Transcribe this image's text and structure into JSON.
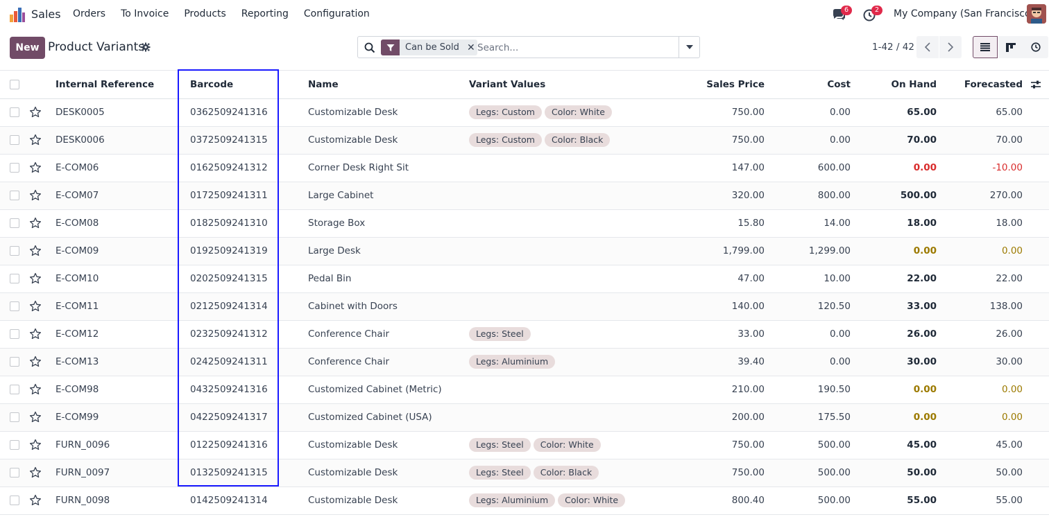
{
  "nav": {
    "app_name": "Sales",
    "menu": [
      "Orders",
      "To Invoice",
      "Products",
      "Reporting",
      "Configuration"
    ],
    "chat_badge": "6",
    "activity_badge": "2",
    "company": "My Company (San Francisco)"
  },
  "control": {
    "new_label": "New",
    "title": "Product Variants",
    "facet_label": "Can be Sold",
    "search_placeholder": "Search...",
    "pager": "1-42 / 42"
  },
  "table": {
    "headers": {
      "ref": "Internal Reference",
      "barcode": "Barcode",
      "name": "Name",
      "variants": "Variant Values",
      "price": "Sales Price",
      "cost": "Cost",
      "on_hand": "On Hand",
      "forecasted": "Forecasted"
    },
    "rows": [
      {
        "ref": "DESK0005",
        "barcode": "0362509241316",
        "name": "Customizable Desk",
        "tags": [
          "Legs: Custom",
          "Color: White"
        ],
        "price": "750.00",
        "cost": "0.00",
        "on_hand": "65.00",
        "forecasted": "65.00",
        "state": "normal"
      },
      {
        "ref": "DESK0006",
        "barcode": "0372509241315",
        "name": "Customizable Desk",
        "tags": [
          "Legs: Custom",
          "Color: Black"
        ],
        "price": "750.00",
        "cost": "0.00",
        "on_hand": "70.00",
        "forecasted": "70.00",
        "state": "normal"
      },
      {
        "ref": "E-COM06",
        "barcode": "0162509241312",
        "name": "Corner Desk Right Sit",
        "tags": [],
        "price": "147.00",
        "cost": "600.00",
        "on_hand": "0.00",
        "forecasted": "-10.00",
        "state": "negative"
      },
      {
        "ref": "E-COM07",
        "barcode": "0172509241311",
        "name": "Large Cabinet",
        "tags": [],
        "price": "320.00",
        "cost": "800.00",
        "on_hand": "500.00",
        "forecasted": "270.00",
        "state": "normal"
      },
      {
        "ref": "E-COM08",
        "barcode": "0182509241310",
        "name": "Storage Box",
        "tags": [],
        "price": "15.80",
        "cost": "14.00",
        "on_hand": "18.00",
        "forecasted": "18.00",
        "state": "normal"
      },
      {
        "ref": "E-COM09",
        "barcode": "0192509241319",
        "name": "Large Desk",
        "tags": [],
        "price": "1,799.00",
        "cost": "1,299.00",
        "on_hand": "0.00",
        "forecasted": "0.00",
        "state": "zero"
      },
      {
        "ref": "E-COM10",
        "barcode": "0202509241315",
        "name": "Pedal Bin",
        "tags": [],
        "price": "47.00",
        "cost": "10.00",
        "on_hand": "22.00",
        "forecasted": "22.00",
        "state": "normal"
      },
      {
        "ref": "E-COM11",
        "barcode": "0212509241314",
        "name": "Cabinet with Doors",
        "tags": [],
        "price": "140.00",
        "cost": "120.50",
        "on_hand": "33.00",
        "forecasted": "138.00",
        "state": "normal"
      },
      {
        "ref": "E-COM12",
        "barcode": "0232509241312",
        "name": "Conference Chair",
        "tags": [
          "Legs: Steel"
        ],
        "price": "33.00",
        "cost": "0.00",
        "on_hand": "26.00",
        "forecasted": "26.00",
        "state": "normal"
      },
      {
        "ref": "E-COM13",
        "barcode": "0242509241311",
        "name": "Conference Chair",
        "tags": [
          "Legs: Aluminium"
        ],
        "price": "39.40",
        "cost": "0.00",
        "on_hand": "30.00",
        "forecasted": "30.00",
        "state": "normal"
      },
      {
        "ref": "E-COM98",
        "barcode": "0432509241316",
        "name": "Customized Cabinet (Metric)",
        "tags": [],
        "price": "210.00",
        "cost": "190.50",
        "on_hand": "0.00",
        "forecasted": "0.00",
        "state": "zero"
      },
      {
        "ref": "E-COM99",
        "barcode": "0422509241317",
        "name": "Customized Cabinet (USA)",
        "tags": [],
        "price": "200.00",
        "cost": "175.50",
        "on_hand": "0.00",
        "forecasted": "0.00",
        "state": "zero"
      },
      {
        "ref": "FURN_0096",
        "barcode": "0122509241316",
        "name": "Customizable Desk",
        "tags": [
          "Legs: Steel",
          "Color: White"
        ],
        "price": "750.00",
        "cost": "500.00",
        "on_hand": "45.00",
        "forecasted": "45.00",
        "state": "normal"
      },
      {
        "ref": "FURN_0097",
        "barcode": "0132509241315",
        "name": "Customizable Desk",
        "tags": [
          "Legs: Steel",
          "Color: Black"
        ],
        "price": "750.00",
        "cost": "500.00",
        "on_hand": "50.00",
        "forecasted": "50.00",
        "state": "normal"
      },
      {
        "ref": "FURN_0098",
        "barcode": "0142509241314",
        "name": "Customizable Desk",
        "tags": [
          "Legs: Aluminium",
          "Color: White"
        ],
        "price": "800.40",
        "cost": "500.00",
        "on_hand": "55.00",
        "forecasted": "55.00",
        "state": "normal"
      }
    ]
  },
  "colors": {
    "brand": "#714b67",
    "highlight": "#1a1aff",
    "negative": "#d92c2c",
    "warning": "#9c7a00"
  }
}
